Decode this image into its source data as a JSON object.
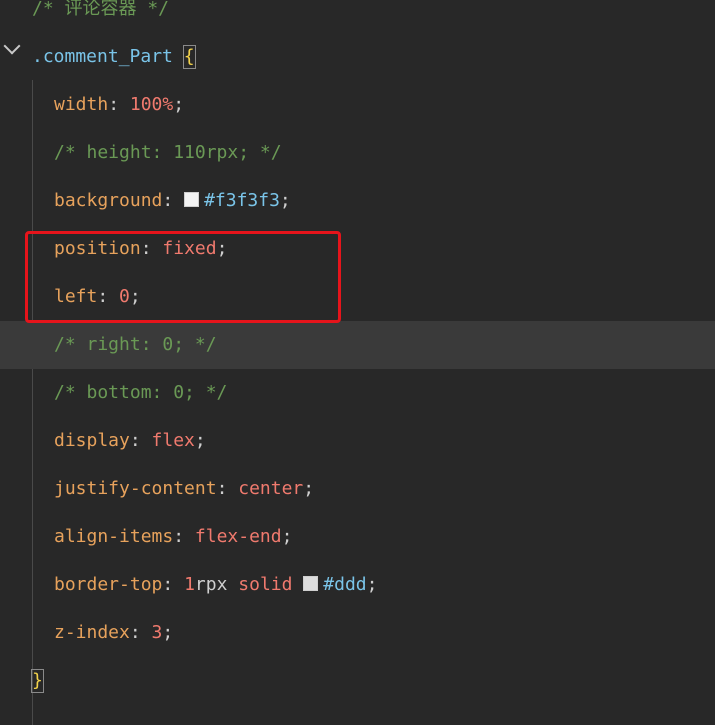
{
  "editor": {
    "lines": [
      {
        "comment": "/* 评论容器 */"
      },
      {
        "selector": ".comment_Part",
        "brace_open": "{"
      },
      {
        "prop": "width",
        "colon": ":",
        "value": "100%",
        "semicolon": ";"
      },
      {
        "comment": "/* height: 110rpx; */"
      },
      {
        "prop": "background",
        "colon": ":",
        "swatch_color": "#f3f3f3",
        "hex": "#f3f3f3",
        "semicolon": ";"
      },
      {
        "prop": "position",
        "colon": ":",
        "value": "fixed",
        "semicolon": ";"
      },
      {
        "prop": "left",
        "colon": ":",
        "value": "0",
        "semicolon": ";"
      },
      {
        "comment": "/* right: 0; */"
      },
      {
        "comment": "/* bottom: 0; */"
      },
      {
        "prop": "display",
        "colon": ":",
        "value": "flex",
        "semicolon": ";"
      },
      {
        "prop": "justify-content",
        "colon": ":",
        "value": "center",
        "semicolon": ";"
      },
      {
        "prop": "align-items",
        "colon": ":",
        "value": "flex-end",
        "semicolon": ";"
      },
      {
        "prop": "border-top",
        "colon": ":",
        "num": "1",
        "unit": "rpx",
        "value": "solid",
        "swatch_color": "#ddd",
        "hex": "#ddd",
        "semicolon": ";"
      },
      {
        "prop": "z-index",
        "colon": ":",
        "value": "3",
        "semicolon": ";"
      },
      {
        "brace_close": "}"
      }
    ],
    "current_line_index": 7,
    "highlight_color": "#e6141b"
  }
}
